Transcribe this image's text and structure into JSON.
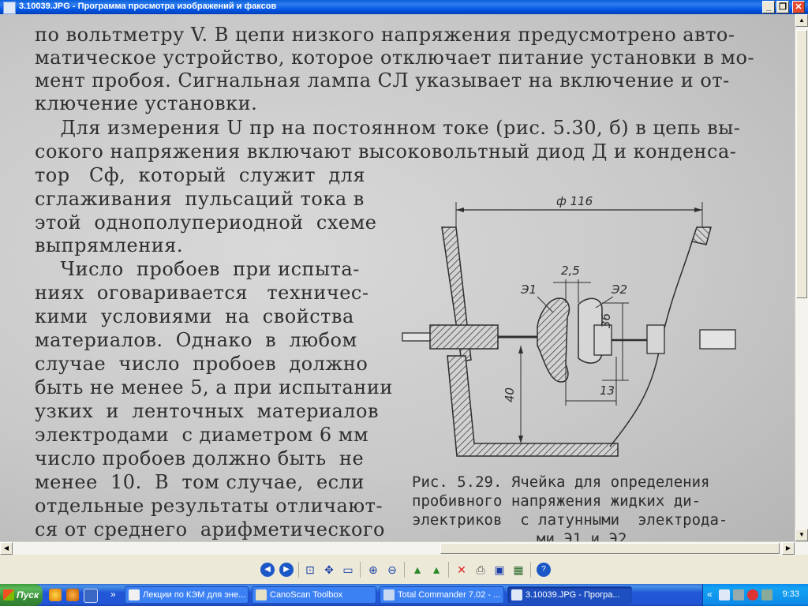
{
  "window": {
    "title": "3.10039.JPG - Программа просмотра изображений и факсов",
    "minimize": "_",
    "restore": "❐",
    "close": "✕"
  },
  "document": {
    "full_lines": [
      "по вольтметру V. В цепи низкого напряжения предусмотрено авто-",
      "матическое устройство, которое отключает питание установки в мо-",
      "мент пробоя. Сигнальная лампа СЛ указывает на включение и от-",
      "ключение установки.",
      "    Для измерения U пр на постоянном токе (рис. 5.30, б) в цепь вы-",
      "сокого напряжения включают высоковольтный диод Д и конденса-"
    ],
    "column_lines": [
      "тор   Cф,  который  служит  для",
      "сглаживания  пульсаций тока в",
      "этой  однополупериодной  схеме",
      "выпрямления.",
      "    Число  пробоев  при испыта-",
      "ниях  оговаривается   техничес-",
      "кими  условиями  на  свойства",
      "материалов.  Однако  в  любом",
      "случае  число  пробоев  должно",
      "быть не менее 5, а при испытании",
      "узких  и  ленточных  материалов",
      "электродами  с диаметром 6 мм",
      "число пробоев должно быть  не",
      "менее  10.  В  том случае,  если",
      "отдельные результаты отличают-",
      "ся от среднего  арифметического"
    ],
    "caption_lines": [
      "Рис. 5.29. Ячейка для определения",
      "пробивного напряжения жидких ди-",
      "электриков  с латунными  электрода-",
      "ми Э1 и Э2"
    ],
    "figure": {
      "dim_diameter": "ф 116",
      "dim_gap": "2,5",
      "label_e1": "Э1",
      "label_e2": "Э2",
      "dim_36": "36",
      "dim_40": "40",
      "dim_13": "13"
    }
  },
  "toolbar": {
    "buttons": [
      "prev-image",
      "next-image",
      "best-fit",
      "actual-size",
      "slideshow",
      "zoom-in",
      "zoom-out",
      "rotate-clockwise",
      "rotate-counterclockwise",
      "delete",
      "print",
      "save",
      "open-editor",
      "help"
    ]
  },
  "taskbar": {
    "start_label": "Пуск",
    "overflow_label": "»",
    "tasks": [
      {
        "label": "Лекции по КЭМ для эне...",
        "active": false
      },
      {
        "label": "CanoScan Toolbox",
        "active": false
      },
      {
        "label": "Total Commander 7.02 - ...",
        "active": false
      },
      {
        "label": "3.10039.JPG - Програ...",
        "active": true
      }
    ],
    "tray_expand": "«",
    "clock": "9:33"
  },
  "colors": {
    "titlebar": "#0054e3",
    "taskbar": "#2157d7",
    "start_button": "#3a913a",
    "paper": "#cccccc",
    "ink": "#2e2e2e"
  }
}
